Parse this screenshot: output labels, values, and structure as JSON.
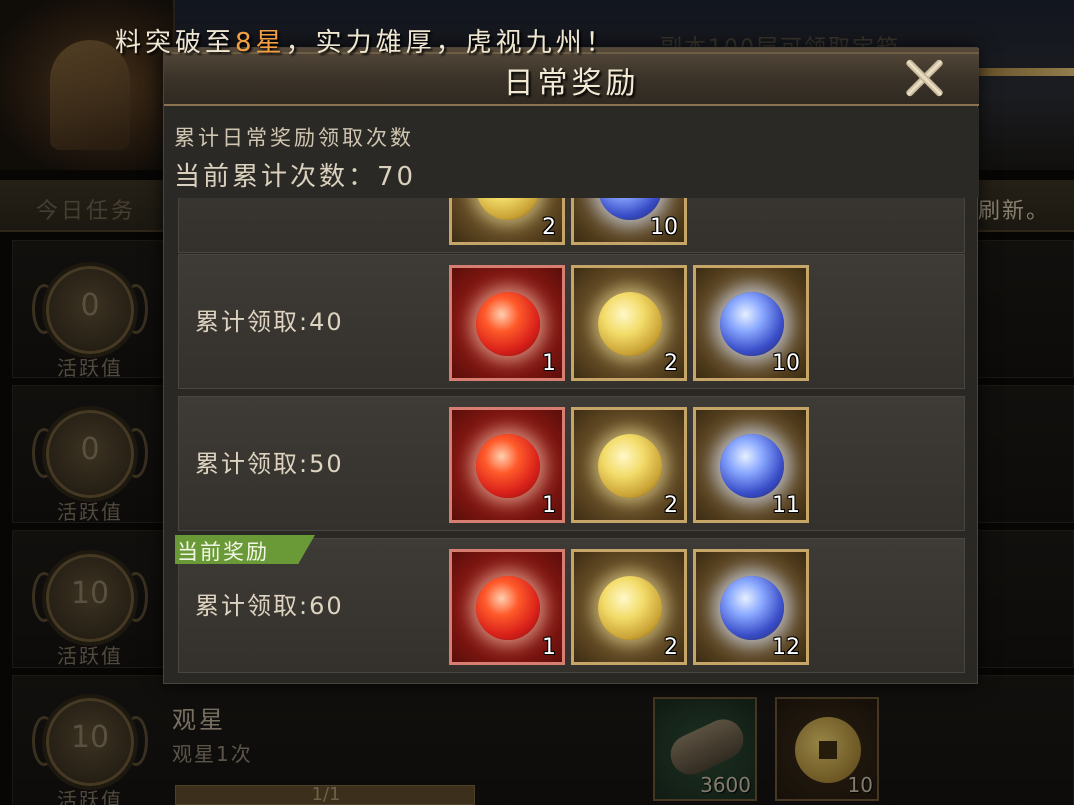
{
  "background": {
    "notice_prefix": "料突破至",
    "notice_highlight": "8星",
    "notice_suffix": "，实力雄厚，虎视九州！",
    "banner_text": "副本100层可领取宝箱",
    "tab_label": "今日任务",
    "refresh_text": "刷新。",
    "activity_rows": [
      {
        "value": "0",
        "caption": "活跃值"
      },
      {
        "value": "0",
        "caption": "活跃值"
      },
      {
        "value": "10",
        "caption": "活跃值"
      },
      {
        "value": "10",
        "caption": "活跃值"
      }
    ],
    "task": {
      "title": "观星",
      "desc": "观星1次",
      "progress_text": "1/1",
      "progress": 1.0,
      "rewards": [
        {
          "icon": "wood-bundle-icon",
          "qty": "3600"
        },
        {
          "icon": "coin-icon",
          "qty": "10"
        }
      ]
    }
  },
  "modal": {
    "title": "日常奖励",
    "info_label": "累计日常奖励领取次数",
    "count_label": "当前累计次数：",
    "count_value": "70",
    "current_tag": "当前奖励",
    "rows": [
      {
        "label": "",
        "items": [
          {
            "type": "gold",
            "icon": "gold-star-orb-icon",
            "qty": "2"
          },
          {
            "type": "blue",
            "icon": "blue-star-orb-icon",
            "qty": "10"
          }
        ]
      },
      {
        "label": "累计领取:40",
        "items": [
          {
            "type": "red",
            "icon": "red-star-orb-icon",
            "qty": "1"
          },
          {
            "type": "gold",
            "icon": "gold-star-orb-icon",
            "qty": "2"
          },
          {
            "type": "blue",
            "icon": "blue-star-orb-icon",
            "qty": "10"
          }
        ]
      },
      {
        "label": "累计领取:50",
        "items": [
          {
            "type": "red",
            "icon": "red-star-orb-icon",
            "qty": "1"
          },
          {
            "type": "gold",
            "icon": "gold-star-orb-icon",
            "qty": "2"
          },
          {
            "type": "blue",
            "icon": "blue-star-orb-icon",
            "qty": "11"
          }
        ]
      },
      {
        "label": "累计领取:60",
        "items": [
          {
            "type": "red",
            "icon": "red-star-orb-icon",
            "qty": "1"
          },
          {
            "type": "gold",
            "icon": "gold-star-orb-icon",
            "qty": "2"
          },
          {
            "type": "blue",
            "icon": "blue-star-orb-icon",
            "qty": "12"
          }
        ]
      }
    ]
  }
}
